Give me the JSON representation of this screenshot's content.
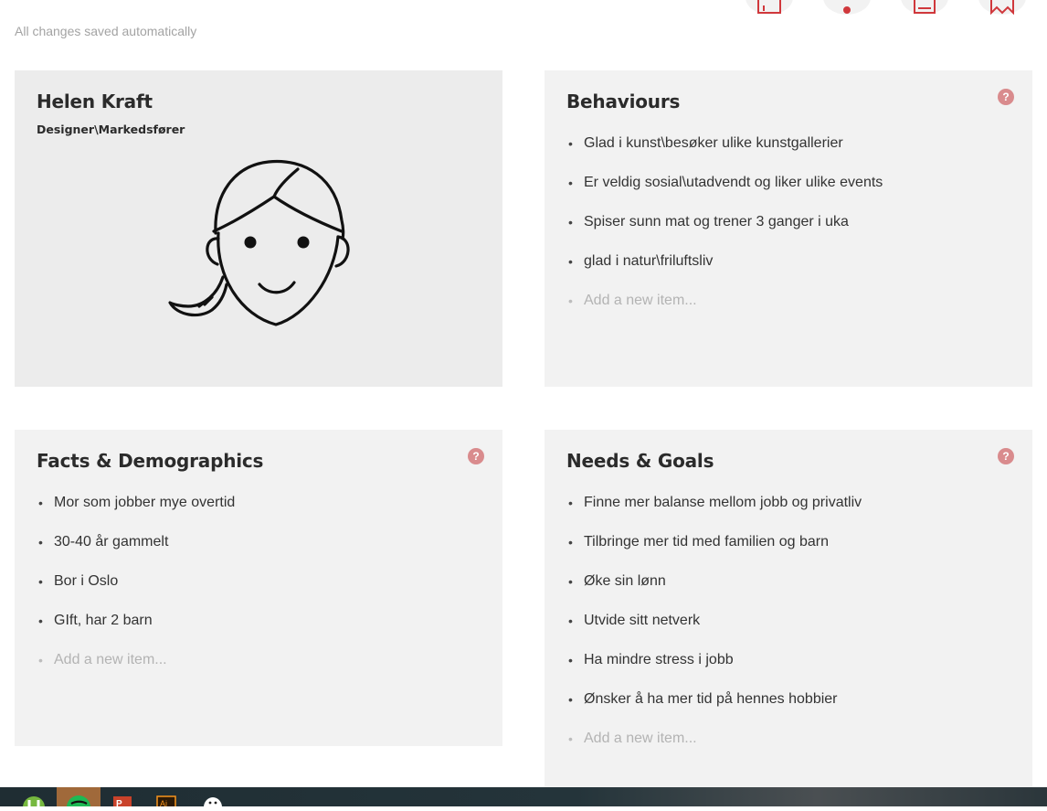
{
  "status": {
    "saved_text": "All changes saved automatically"
  },
  "toolbar": {
    "icons": [
      "chart-icon",
      "record-icon",
      "document-icon",
      "bookmark-icon"
    ]
  },
  "profile": {
    "name": "Helen Kraft",
    "role": "Designer\\Markedsfører",
    "avatar": "woman-face-avatar"
  },
  "behaviours": {
    "title": "Behaviours",
    "help": "?",
    "items": [
      "Glad i kunst\\besøker ulike kunstgallerier",
      "Er veldig sosial\\utadvendt og liker ulike events",
      "Spiser sunn mat og trener 3 ganger i uka",
      "glad i natur\\friluftsliv"
    ],
    "add_placeholder": "Add a new item..."
  },
  "facts": {
    "title": "Facts & Demographics",
    "help": "?",
    "items": [
      "Mor som jobber mye overtid",
      "30-40 år gammelt",
      "Bor i Oslo",
      "GIft, har 2 barn"
    ],
    "add_placeholder": "Add a new item..."
  },
  "needs": {
    "title": "Needs & Goals",
    "help": "?",
    "items": [
      "Finne mer balanse mellom jobb og privatliv",
      "Tilbringe mer tid med familien og barn",
      "Øke sin lønn",
      "Utvide sitt netverk",
      "Ha mindre stress i jobb",
      "Ønsker å ha mer tid på hennes hobbier"
    ],
    "add_placeholder": "Add a new item..."
  },
  "taskbar": {
    "apps": [
      "utorrent-icon",
      "spotify-icon",
      "powerpoint-icon",
      "illustrator-icon",
      "ghost-icon"
    ],
    "active_app": "spotify-icon"
  },
  "colors": {
    "accent": "#d0383c",
    "help_badge": "#d98b8d",
    "card_bg": "#f2f2f2",
    "profile_bg": "#ececec",
    "taskbar_bg": "#24343a"
  }
}
